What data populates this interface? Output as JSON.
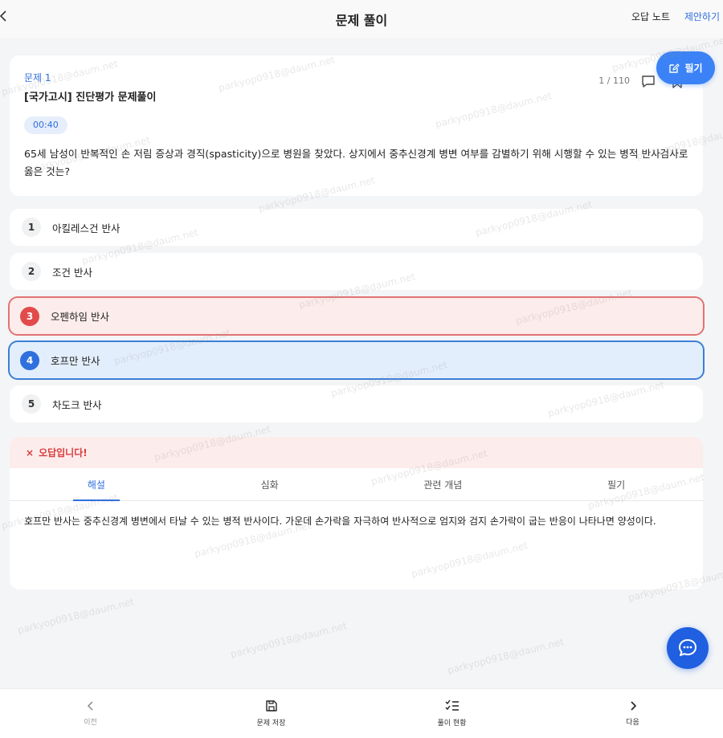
{
  "header": {
    "title": "문제 풀이",
    "wrong_note": "오답 노트",
    "suggest": "제안하기"
  },
  "question": {
    "label": "문제 1",
    "title": "[국가고시] 진단평가 문제풀이",
    "count": "1 / 110",
    "timer": "00:40",
    "text": "65세 남성이 반복적인 손 저림 증상과 경직(spasticity)으로 병원을 찾았다. 상지에서 중추신경계 병변 여부를 감별하기 위해 시행할 수 있는 병적 반사검사로 옳은 것는?"
  },
  "note_fab": {
    "label": "필기"
  },
  "options": [
    {
      "num": "1",
      "text": "아킬레스건 반사",
      "state": "normal"
    },
    {
      "num": "2",
      "text": "조건 반사",
      "state": "normal"
    },
    {
      "num": "3",
      "text": "오펜하임 반사",
      "state": "wrong"
    },
    {
      "num": "4",
      "text": "호프만 반사",
      "state": "correct"
    },
    {
      "num": "5",
      "text": "차도크 반사",
      "state": "normal"
    }
  ],
  "result": {
    "mark": "×",
    "message": "오답입니다!",
    "tabs": [
      "해설",
      "심화",
      "관련 개념",
      "필기"
    ],
    "active_tab": "해설",
    "explanation": "호프만 반사는 중추신경계 병변에서 타날 수 있는 병적 반사이다. 가운데 손가락을 자극하여 반사적으로 엄지와 검지 손가락이 굽는 반응이 나타나면 양성이다."
  },
  "bottom_nav": {
    "prev": "이전",
    "save": "문제 저장",
    "status": "풀이 현황",
    "next": "다음"
  },
  "watermark": "parkyop0918@daum.net",
  "colors": {
    "accent": "#2f6fde",
    "wrong": "#e24b4b",
    "wrong_bg": "#fdecec",
    "correct_bg": "#e3eefc"
  }
}
